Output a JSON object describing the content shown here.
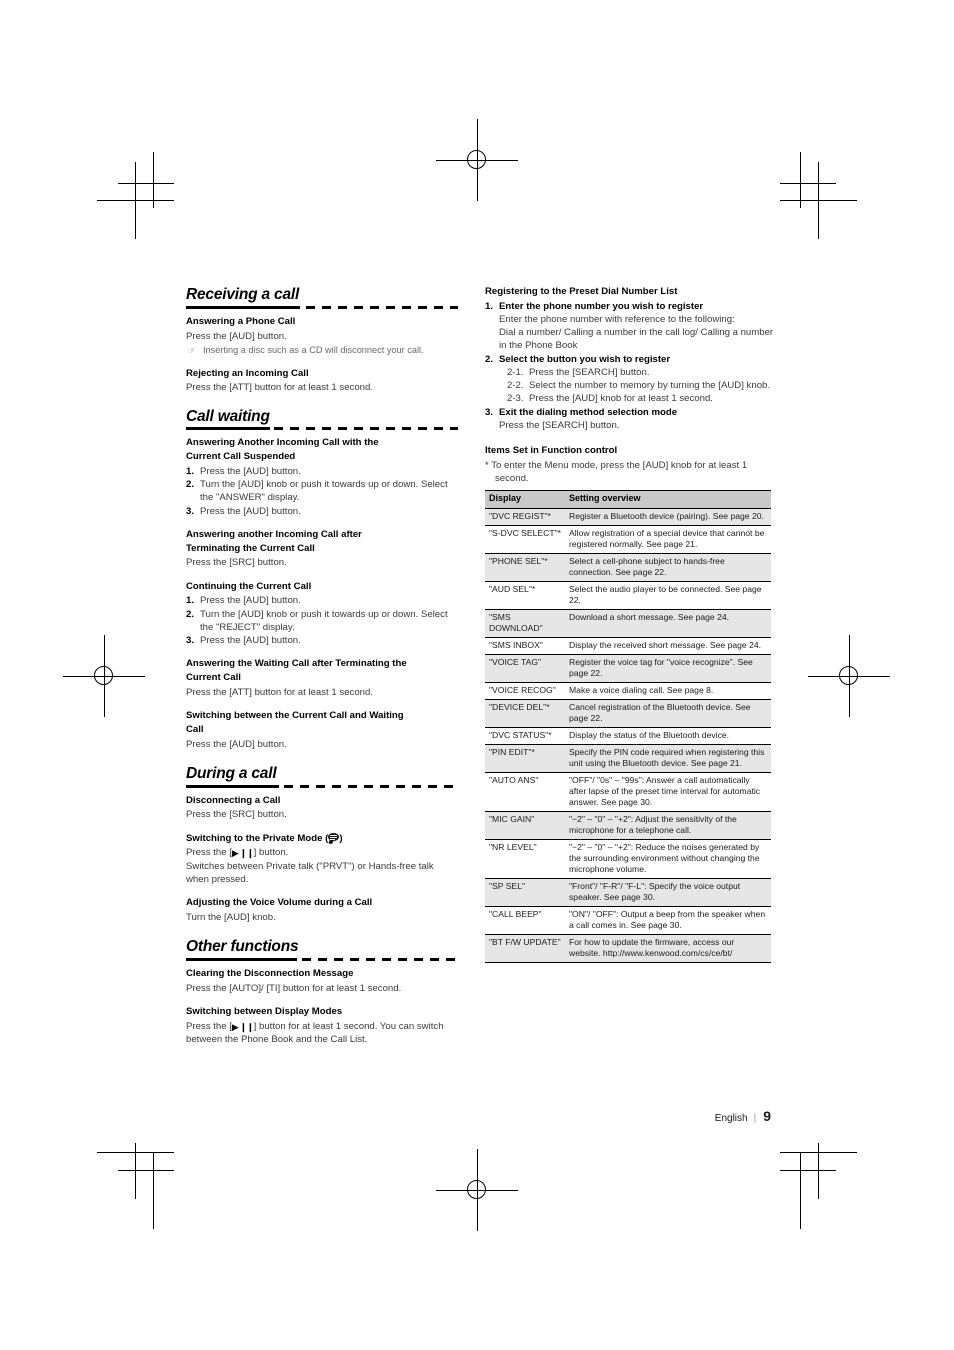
{
  "page": {
    "footer_language": "English",
    "footer_separator": "|",
    "footer_page_number": "9"
  },
  "left_column": {
    "sections": [
      {
        "heading": "Receiving a call",
        "blocks": [
          {
            "sub_head": "Answering a Phone Call",
            "lines": [
              "Press the [AUD] button."
            ],
            "note": "Inserting a disc such as a CD will disconnect your call."
          },
          {
            "sub_head": "Rejecting an Incoming Call",
            "lines": [
              "Press the [ATT] button for at least 1 second."
            ]
          }
        ]
      },
      {
        "heading": "Call waiting",
        "blocks": [
          {
            "sub_head_l1": "Answering Another Incoming Call with the",
            "sub_head_l2": "Current Call Suspended",
            "steps": [
              {
                "n": "1.",
                "t": "Press the [AUD] button."
              },
              {
                "n": "2.",
                "t": "Turn the [AUD] knob or push it towards up or down. Select the \"ANSWER\" display."
              },
              {
                "n": "3.",
                "t": "Press the [AUD] button."
              }
            ]
          },
          {
            "sub_head_l1": "Answering another Incoming Call after",
            "sub_head_l2": "Terminating the Current Call",
            "lines": [
              "Press the [SRC] button."
            ]
          },
          {
            "sub_head": "Continuing the Current Call",
            "steps": [
              {
                "n": "1.",
                "t": "Press the [AUD] button."
              },
              {
                "n": "2.",
                "t": "Turn the [AUD] knob or push it towards up or down. Select the \"REJECT\" display."
              },
              {
                "n": "3.",
                "t": "Press the [AUD] button."
              }
            ]
          },
          {
            "sub_head_l1": "Answering the Waiting Call after Terminating the",
            "sub_head_l2": "Current Call",
            "lines": [
              "Press the [ATT] button for at least 1 second."
            ]
          },
          {
            "sub_head_l1": "Switching between the Current Call and Waiting",
            "sub_head_l2": "Call",
            "lines": [
              "Press the [AUD] button."
            ]
          }
        ]
      },
      {
        "heading": "During a call",
        "blocks": [
          {
            "sub_head": "Disconnecting a Call",
            "lines": [
              "Press the [SRC] button."
            ]
          },
          {
            "sub_head_pre": "Switching to the Private Mode (",
            "sub_head_post": ")",
            "line_pre": "Press the [",
            "line_glyph": "▶ ❙❙",
            "line_post": "] button.",
            "lines_extra": [
              "Switches between Private talk (\"PRVT\") or Hands-free talk when pressed."
            ]
          },
          {
            "sub_head": "Adjusting the Voice Volume during a Call",
            "lines": [
              "Turn the [AUD] knob."
            ]
          }
        ]
      },
      {
        "heading": "Other functions",
        "blocks": [
          {
            "sub_head": "Clearing the Disconnection Message",
            "lines": [
              "Press the [AUTO]/ [TI] button for at least 1 second."
            ]
          },
          {
            "sub_head": "Switching between Display Modes",
            "line_pre": "Press the [",
            "line_glyph": "▶ ❙❙",
            "line_post": "] button for at least 1 second. You can switch between the Phone Book and the Call List."
          }
        ]
      }
    ]
  },
  "right_column": {
    "preset_dial": {
      "heading": "Registering to the Preset Dial Number List",
      "steps": [
        {
          "n": "1.",
          "title": "Enter the phone number you wish to register",
          "detail_lines": [
            "Enter the phone number with reference to the following:",
            "Dial a number/ Calling a number in the call log/ Calling a number in the Phone Book"
          ]
        },
        {
          "n": "2.",
          "title": "Select the button you wish to register",
          "sub_steps": [
            {
              "n": "2-1.",
              "t": "Press the [SEARCH] button."
            },
            {
              "n": "2-2.",
              "t": "Select the number to memory by turning the [AUD] knob."
            },
            {
              "n": "2-3.",
              "t": "Press the [AUD] knob for at least 1 second."
            }
          ]
        },
        {
          "n": "3.",
          "title": "Exit the dialing method selection mode",
          "detail_lines": [
            "Press the [SEARCH] button."
          ]
        }
      ]
    },
    "function_control": {
      "heading": "Items Set in Function control",
      "note": "* To enter the Menu mode, press the [AUD] knob for at least 1 second.",
      "table": {
        "headers": [
          "Display",
          "Setting overview"
        ],
        "rows": [
          {
            "display": "\"DVC REGIST\"*",
            "overview": "Register a Bluetooth device (pairing). See page 20.",
            "shade": true
          },
          {
            "display": "\"S-DVC SELECT\"*",
            "overview": "Allow registration of a special device that cannot be registered normally. See page 21.",
            "shade": false
          },
          {
            "display": "\"PHONE SEL\"*",
            "overview": "Select a cell-phone subject to hands-free connection. See page 22.",
            "shade": true
          },
          {
            "display": "\"AUD SEL\"*",
            "overview": "Select the audio player to be connected. See page 22.",
            "shade": false
          },
          {
            "display": "\"SMS DOWNLOAD\"",
            "overview": "Download a short message. See page 24.",
            "shade": true
          },
          {
            "display": "\"SMS INBOX\"",
            "overview": "Display the received short message. See page 24.",
            "shade": false
          },
          {
            "display": "\"VOICE TAG\"",
            "overview": "Register the voice tag for \"voice recognize\". See page 22.",
            "shade": true
          },
          {
            "display": "\"VOICE RECOG\"",
            "overview": "Make a voice dialing call. See page 8.",
            "shade": false
          },
          {
            "display": "\"DEVICE DEL\"*",
            "overview": "Cancel registration of the Bluetooth device. See page 22.",
            "shade": true
          },
          {
            "display": "\"DVC STATUS\"*",
            "overview": "Display the status of the Bluetooth device.",
            "shade": false
          },
          {
            "display": "\"PIN EDIT\"*",
            "overview": "Specify the PIN code required when registering this unit using the Bluetooth device. See page 21.",
            "shade": true
          },
          {
            "display": "\"AUTO ANS\"",
            "overview": "\"OFF\"/ \"0s\" – \"99s\": Answer a call automatically after lapse of the preset time interval for automatic answer. See page 30.",
            "shade": false
          },
          {
            "display": "\"MIC GAIN\"",
            "overview": "\"−2\" – \"0\" – \"+2\": Adjust the sensitivity of the microphone for a telephone call.",
            "shade": true
          },
          {
            "display": "\"NR LEVEL\"",
            "overview": "\"−2\" – \"0\" – \"+2\": Reduce the noises generated by the surrounding environment without changing the microphone volume.",
            "shade": false
          },
          {
            "display": "\"SP SEL\"",
            "overview": "\"Front\"/ \"F-R\"/ \"F-L\": Specify the voice output speaker. See page 30.",
            "shade": true
          },
          {
            "display": "\"CALL BEEP\"",
            "overview": "\"ON\"/ \"OFF\": Output a beep from the speaker when a call comes in. See page 30.",
            "shade": false
          },
          {
            "display": "\"BT F/W UPDATE\"",
            "overview": "For how to update the firmware, access our website. http://www.kenwood.com/cs/ce/bt/",
            "shade": true
          }
        ]
      }
    }
  }
}
